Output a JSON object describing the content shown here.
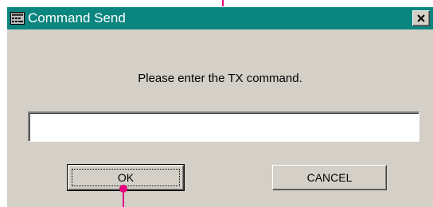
{
  "window": {
    "title": "Command Send",
    "close_glyph": "×"
  },
  "dialog": {
    "prompt": "Please enter the TX command.",
    "command_input": {
      "value": "",
      "placeholder": ""
    },
    "ok_label": "OK",
    "cancel_label": "CANCEL"
  },
  "colors": {
    "titlebar": "#0a857f",
    "dialog_face": "#d4d0c8",
    "callout": "#e6007e"
  },
  "icons": {
    "app": "app-window-icon",
    "close": "close-icon"
  }
}
